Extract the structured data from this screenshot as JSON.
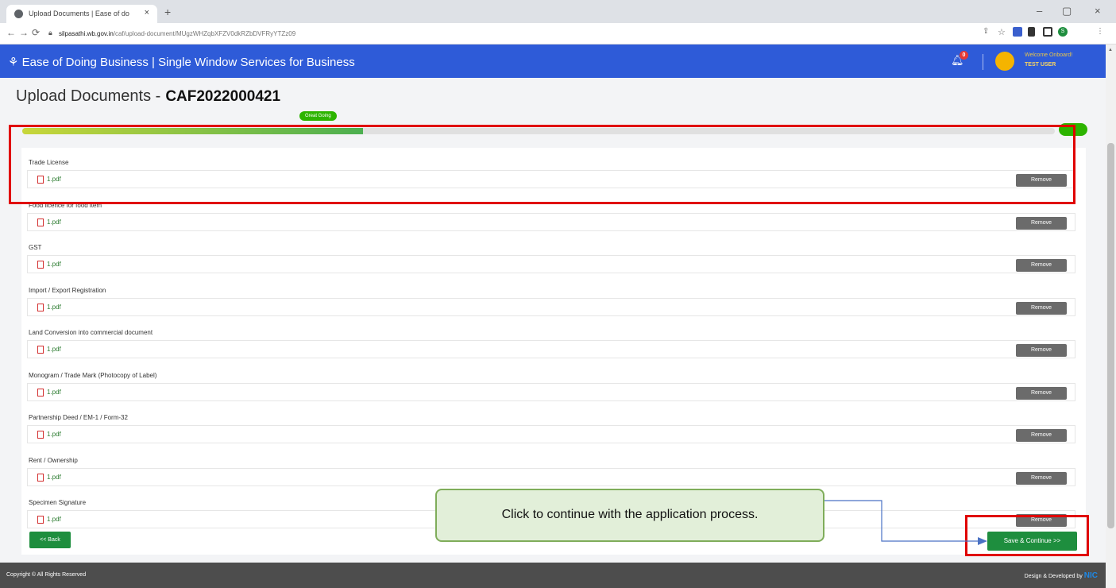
{
  "browser": {
    "tab_title": "Upload Documents | Ease of do",
    "tab_close": "×",
    "new_tab": "+",
    "url_host": "silpasathi.wb.gov.in",
    "url_path": "/caf/upload-document/MUgzWHZqbXFZV0dkRZbDVFRyYTZz09",
    "win_min": "–",
    "win_max": "▢",
    "win_close": "×",
    "profile_initial": "S",
    "avatar_color": "#1e8e3e"
  },
  "header": {
    "title": "Ease of Doing Business | Single Window Services for Business",
    "notification_count": "0",
    "welcome": "Welcome Onboard!",
    "user": "TEST USER",
    "bg_color": "#2e5bd8"
  },
  "page": {
    "title": "Upload Documents -",
    "caf_id": "CAF2022000421",
    "progress_badge": "Great Going",
    "progress": 0.33
  },
  "documents": [
    {
      "label": "Trade License",
      "file": "1.pdf",
      "remove": "Remove"
    },
    {
      "label": "Food licence for food item",
      "file": "1.pdf",
      "remove": "Remove"
    },
    {
      "label": "GST",
      "file": "1.pdf",
      "remove": "Remove"
    },
    {
      "label": "Import / Export Registration",
      "file": "1.pdf",
      "remove": "Remove"
    },
    {
      "label": "Land Conversion into commercial document",
      "file": "1.pdf",
      "remove": "Remove"
    },
    {
      "label": "Monogram / Trade Mark (Photocopy of Label)",
      "file": "1.pdf",
      "remove": "Remove"
    },
    {
      "label": "Partnership Deed / EM-1 / Form-32",
      "file": "1.pdf",
      "remove": "Remove"
    },
    {
      "label": "Rent / Ownership",
      "file": "1.pdf",
      "remove": "Remove"
    },
    {
      "label": "Specimen Signature",
      "file": "1.pdf",
      "remove": "Remove"
    }
  ],
  "actions": {
    "back": "<< Back",
    "save_continue": "Save & Continue >>"
  },
  "footer": {
    "copyright": "Copyright © All Rights Reserved",
    "credits": "Design & Developed by",
    "nic": "NIC"
  },
  "annotation": {
    "callout": "Click to continue with the application process.",
    "highlight_color": "#e00000"
  }
}
